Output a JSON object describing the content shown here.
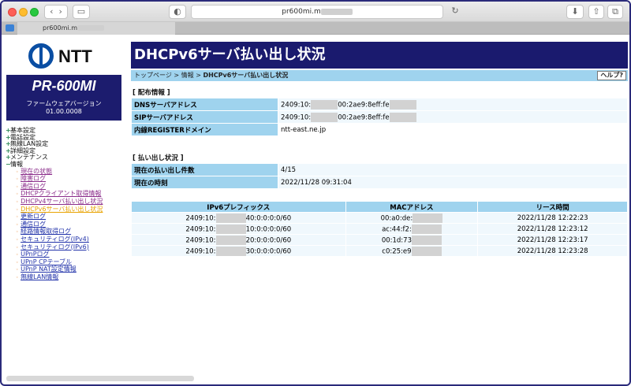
{
  "browser": {
    "url": "pr600mi.m",
    "tab_title": "pr600mi.m"
  },
  "sidebar": {
    "logo_text": "NTT",
    "model": "PR-600MI",
    "firmware_label": "ファームウェアバージョン",
    "firmware_version": "01.00.0008",
    "categories": [
      {
        "label": "基本設定",
        "sign": "+"
      },
      {
        "label": "電話設定",
        "sign": "+"
      },
      {
        "label": "無線LAN設定",
        "sign": "+"
      },
      {
        "label": "詳細設定",
        "sign": "+"
      },
      {
        "label": "メンテナンス",
        "sign": "+"
      },
      {
        "label": "情報",
        "sign": "−"
      }
    ],
    "info_items": [
      "現在の状態",
      "障害ログ",
      "通信ログ",
      "DHCPクライアント取得情報",
      "DHCPv4サーバ払い出し状況",
      "DHCPv6サーバ払い出し状況",
      "更新ログ",
      "通信ログ",
      "経路情報取得ログ",
      "セキュリティログ(IPv4)",
      "セキュリティログ(IPv6)",
      "UPnPログ",
      "UPnP CPテーブル",
      "UPnP NAT設定情報",
      "無線LAN情報"
    ]
  },
  "main": {
    "title": "DHCPv6サーバ払い出し状況",
    "breadcrumb": {
      "top": "トップページ",
      "sep": ">",
      "info": "情報",
      "current": "DHCPv6サーバ払い出し状況"
    },
    "help_label": "ヘルプ?",
    "distribution": {
      "heading": "[ 配布情報 ]",
      "rows": [
        {
          "key": "DNSサーバアドレス",
          "v1": "2409:10:",
          "v2": "00:2ae9:8eff:fe"
        },
        {
          "key": "SIPサーバアドレス",
          "v1": "2409:10:",
          "v2": "00:2ae9:8eff:fe"
        },
        {
          "key": "内線REGISTERドメイン",
          "v1": "ntt-east.ne.jp",
          "v2": ""
        }
      ]
    },
    "lease_status": {
      "heading": "[ 払い出し状況 ]",
      "rows": [
        {
          "key": "現在の払い出し件数",
          "value": "4/15"
        },
        {
          "key": "現在の時刻",
          "value": "2022/11/28 09:31:04"
        }
      ]
    },
    "lease_table": {
      "headers": [
        "IPv6プレフィックス",
        "MACアドレス",
        "リース時間"
      ],
      "rows": [
        {
          "p1": "2409:10:",
          "p2": "40:0:0:0:0/60",
          "mac": "00:a0:de:",
          "time": "2022/11/28 12:22:23"
        },
        {
          "p1": "2409:10:",
          "p2": "10:0:0:0:0/60",
          "mac": "ac:44:f2:",
          "time": "2022/11/28 12:23:12"
        },
        {
          "p1": "2409:10:",
          "p2": "20:0:0:0:0/60",
          "mac": "00:1d:73",
          "time": "2022/11/28 12:23:17"
        },
        {
          "p1": "2409:10:",
          "p2": "30:0:0:0:0/60",
          "mac": "c0:25:e9",
          "time": "2022/11/28 12:23:28"
        }
      ]
    }
  }
}
